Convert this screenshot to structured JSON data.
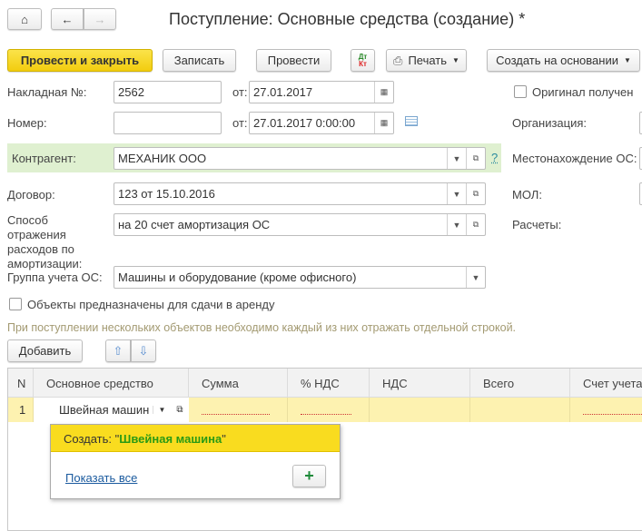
{
  "title": "Поступление: Основные средства (создание) *",
  "toolbar": {
    "post_close": "Провести и закрыть",
    "save": "Записать",
    "post": "Провести",
    "dtkt_dt": "Дт",
    "dtkt_kt": "Кт",
    "print": "Печать",
    "create_based": "Создать на основании"
  },
  "form": {
    "invoice_label": "Накладная №:",
    "invoice_value": "2562",
    "from_label": "от:",
    "invoice_date": "27.01.2017",
    "original_label": "Оригинал получен",
    "number_label": "Номер:",
    "number_value": "",
    "number_date": "27.01.2017  0:00:00",
    "org_label": "Организация:",
    "contractor_label": "Контрагент:",
    "contractor_value": "МЕХАНИК ООО",
    "help": "?",
    "location_label": "Местонахождение ОС:",
    "contract_label": "Договор:",
    "contract_value": "123 от 15.10.2016",
    "mol_label": "МОЛ:",
    "depr_label": "Способ отражения расходов по амортизации:",
    "depr_value": "на 20 счет амортизация ОС",
    "settlements_label": "Расчеты:",
    "group_label": "Группа учета ОС:",
    "group_value": "Машины и оборудование (кроме офисного)",
    "rent_label": "Объекты предназначены для сдачи в аренду",
    "hint": "При поступлении нескольких объектов необходимо каждый из них отражать отдельной строкой."
  },
  "table": {
    "add": "Добавить",
    "columns": [
      "N",
      "Основное средство",
      "Сумма",
      "% НДС",
      "НДС",
      "Всего",
      "Счет учета"
    ],
    "rows": [
      {
        "n": "1",
        "asset": "Швейная машин"
      }
    ]
  },
  "popup": {
    "create_prefix": "Создать: ",
    "create_quote_open": "\"",
    "create_name": "Швейная машина",
    "create_quote_close": "\"",
    "show_all": "Показать все"
  },
  "colors": {
    "accent": "#f2cd0f",
    "green_band": "#dff0d0",
    "row_selected": "#fdf2b0"
  }
}
